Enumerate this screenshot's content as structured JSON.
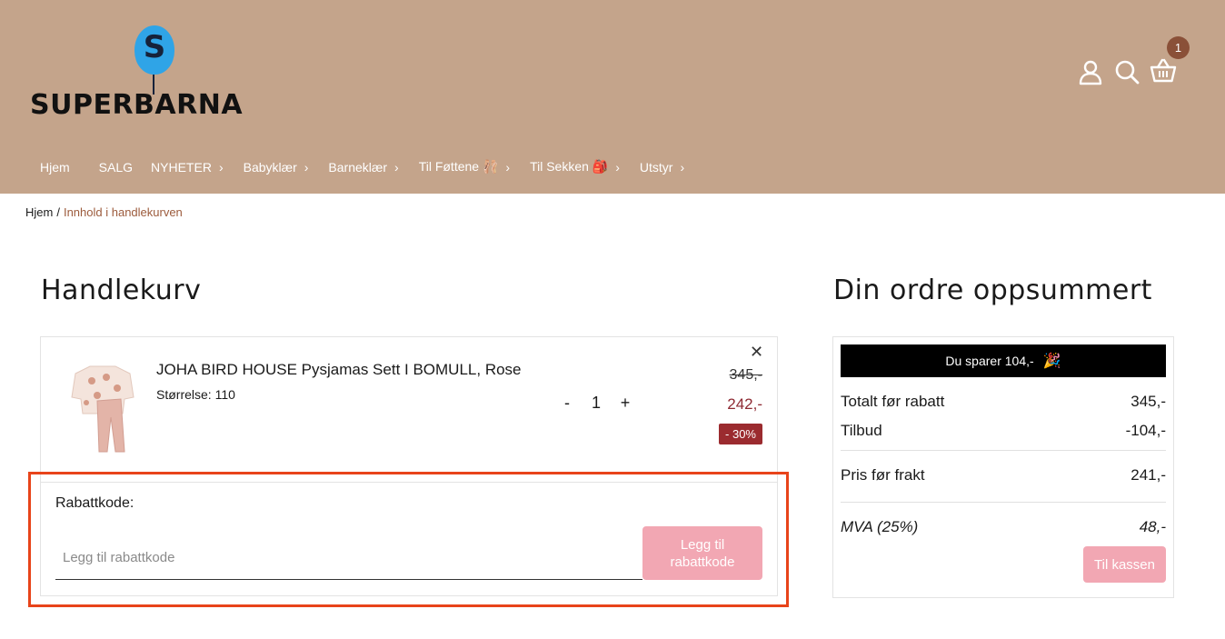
{
  "brand": {
    "logo_letter": "S",
    "logo_text": "SUPERBARNA"
  },
  "header": {
    "cart_count": "1",
    "icons": [
      "user-icon",
      "search-icon",
      "basket-icon"
    ]
  },
  "nav": [
    {
      "label": "Hjem",
      "has_chevron": false
    },
    {
      "label": "SALG",
      "has_chevron": false
    },
    {
      "label": "NYHETER",
      "has_chevron": true
    },
    {
      "label": "Babyklær",
      "has_chevron": true
    },
    {
      "label": "Barneklær",
      "has_chevron": true
    },
    {
      "label": "Til Føttene 🩰",
      "has_chevron": true
    },
    {
      "label": "Til Sekken 🎒",
      "has_chevron": true
    },
    {
      "label": "Utstyr",
      "has_chevron": true
    }
  ],
  "breadcrumb": {
    "home": "Hjem",
    "separator": "/",
    "current": "Innhold i handlekurven"
  },
  "cart": {
    "title": "Handlekurv",
    "item": {
      "name": "JOHA BIRD HOUSE Pysjamas Sett I BOMULL, Rose",
      "size": "Størrelse: 110",
      "quantity": "1",
      "minus": "-",
      "plus": "+",
      "price_old": "345,-",
      "price_new": "242,-",
      "discount": "- 30%",
      "remove": "✕"
    },
    "coupon": {
      "label": "Rabattkode:",
      "placeholder": "Legg til rabattkode",
      "value": "",
      "button_line1": "Legg til",
      "button_line2": "rabattkode"
    }
  },
  "summary": {
    "title": "Din ordre oppsummert",
    "savings_banner": "Du sparer 104,-",
    "savings_emoji": "🎉",
    "rows": [
      {
        "label": "Totalt før rabatt",
        "value": "345,-"
      },
      {
        "label": "Tilbud",
        "value": "-104,-"
      },
      {
        "label": "Pris før frakt",
        "value": "241,-"
      },
      {
        "label": "MVA (25%)",
        "value": "48,-"
      }
    ],
    "checkout_label": "Til kassen"
  },
  "colors": {
    "header_bg": "#c4a48b",
    "badge_bg": "#8a5038",
    "price_sale": "#8e2a33",
    "discount_bg": "#9b2b2f",
    "button_pink": "#f2a7b3",
    "highlight": "#e8441a",
    "breadcrumb_current": "#9c5b3c"
  }
}
